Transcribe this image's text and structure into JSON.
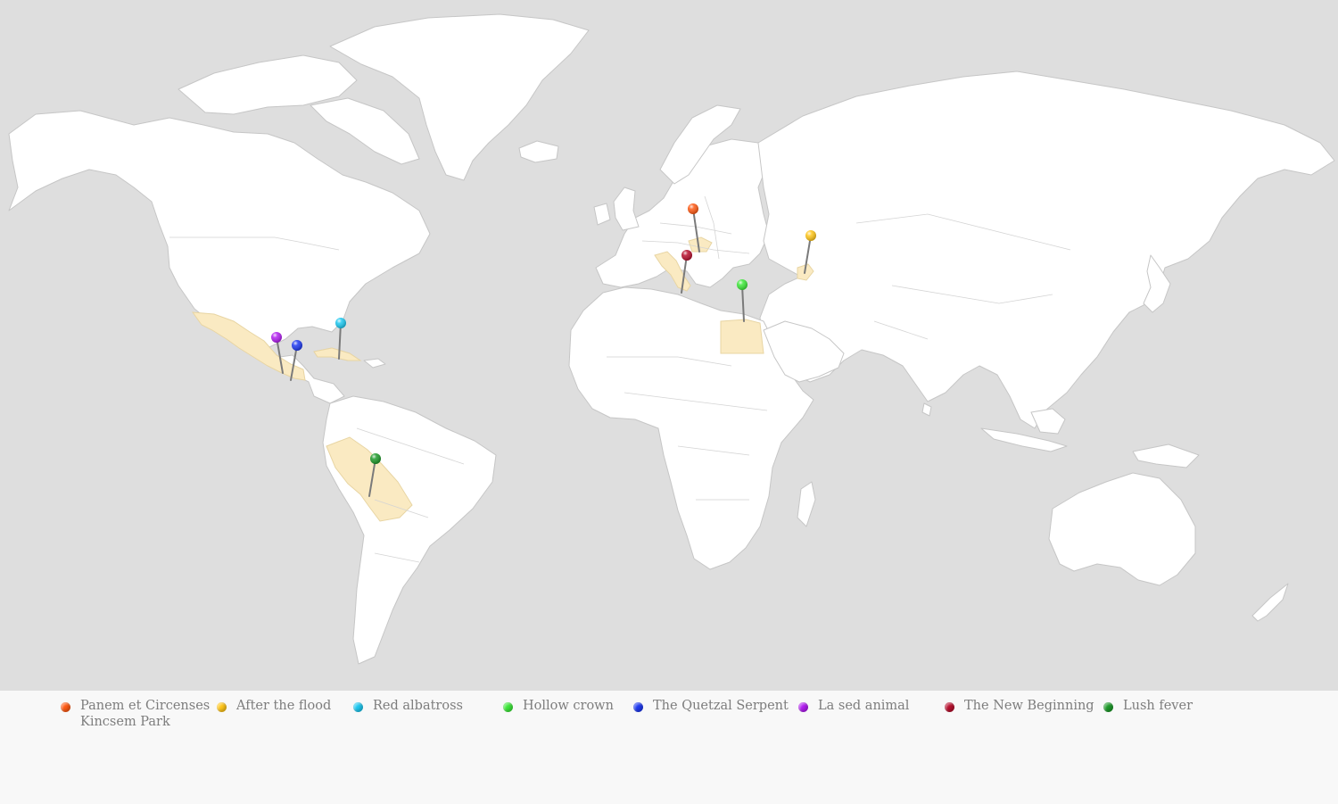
{
  "map": {
    "ocean_color": "#dedede",
    "land_color": "#ffffff",
    "highlight_color": "#faeac2",
    "highlighted_regions": [
      "Mexico",
      "Cuba",
      "Peru",
      "Bolivia",
      "Italy",
      "Hungary",
      "Egypt",
      "Azerbaijan"
    ]
  },
  "pins": [
    {
      "id": "panem",
      "label": "Panem et Circenses",
      "color": "#ff5a14",
      "place": "Poland"
    },
    {
      "id": "flood",
      "label": "After the flood",
      "color": "#ffc61a",
      "place": "Azerbaijan"
    },
    {
      "id": "albatross",
      "label": "Red albatross",
      "color": "#1ec8f0",
      "place": "Cuba"
    },
    {
      "id": "hollow",
      "label": "Hollow crown",
      "color": "#3ee83a",
      "place": "Egypt"
    },
    {
      "id": "quetzal",
      "label": "The Quetzal Serpent",
      "color": "#1f3af0",
      "place": "Mexico"
    },
    {
      "id": "lased",
      "label": "La sed animal",
      "color": "#b21ef0",
      "place": "Mexico"
    },
    {
      "id": "newbeginning",
      "label": "The New Beginning",
      "color": "#b8102e",
      "place": "Italy / Hungary"
    },
    {
      "id": "lush",
      "label": "Lush fever",
      "color": "#1e9a2a",
      "place": "Bolivia"
    }
  ],
  "legend": [
    {
      "lines": [
        "Panem et Circenses",
        "Kincsem Park"
      ],
      "color": "#ff5a14"
    },
    {
      "lines": [
        "After the flood"
      ],
      "color": "#ffc61a"
    },
    {
      "lines": [
        "Red albatross"
      ],
      "color": "#1ec8f0"
    },
    {
      "lines": [
        "Hollow crown"
      ],
      "color": "#3ee83a"
    },
    {
      "lines": [
        "The Quetzal Serpent"
      ],
      "color": "#1f3af0"
    },
    {
      "lines": [
        "La sed animal"
      ],
      "color": "#b21ef0"
    },
    {
      "lines": [
        "The New Beginning"
      ],
      "color": "#b8102e"
    },
    {
      "lines": [
        "Lush fever"
      ],
      "color": "#1e9a2a"
    }
  ]
}
